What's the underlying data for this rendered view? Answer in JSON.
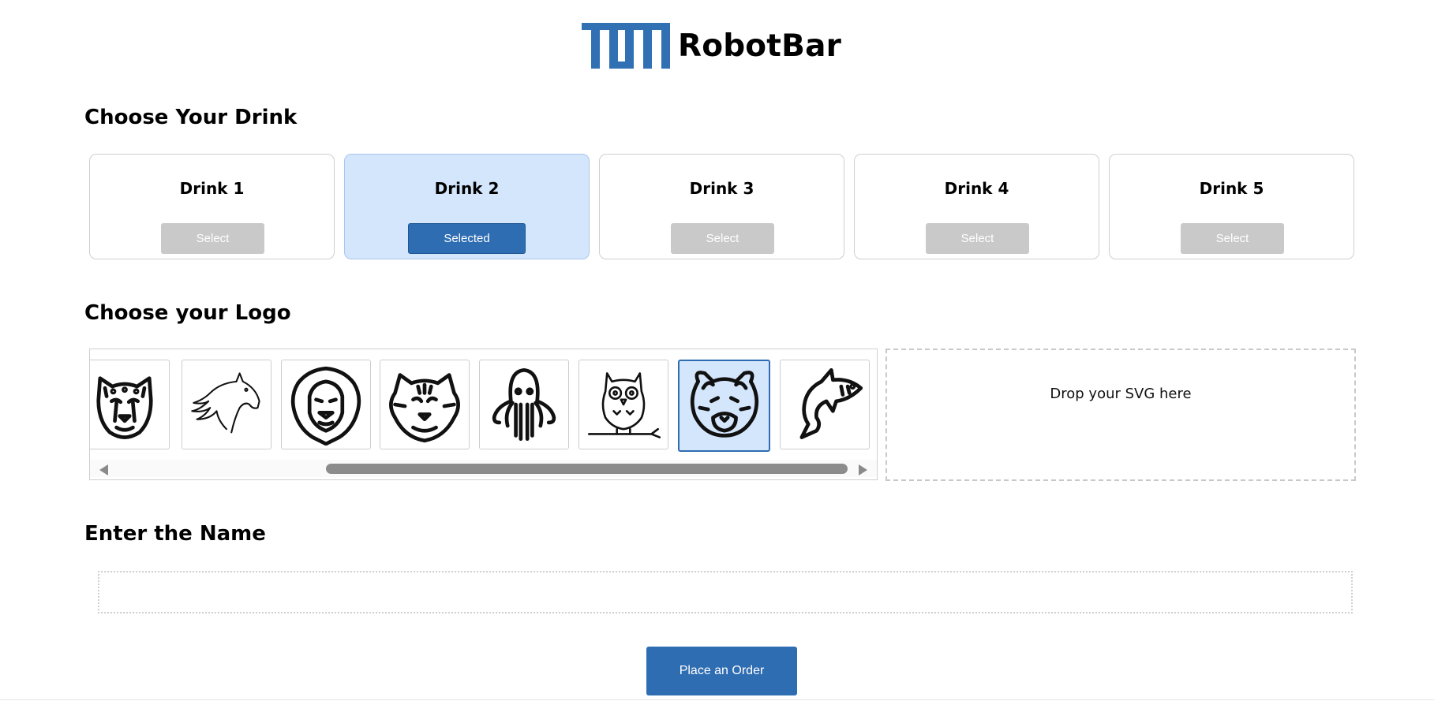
{
  "header": {
    "brand": "RobotBar",
    "logo_icon": "tum-logo-icon",
    "brand_color": "#3070b3"
  },
  "drinks_section": {
    "title": "Choose Your Drink",
    "items": [
      {
        "name": "Drink 1",
        "button": "Select",
        "selected": false
      },
      {
        "name": "Drink 2",
        "button": "Selected",
        "selected": true
      },
      {
        "name": "Drink 3",
        "button": "Select",
        "selected": false
      },
      {
        "name": "Drink 4",
        "button": "Select",
        "selected": false
      },
      {
        "name": "Drink 5",
        "button": "Select",
        "selected": false
      }
    ]
  },
  "logo_section": {
    "title": "Choose your Logo",
    "logos": [
      {
        "icon": "cheetah-icon",
        "selected": false
      },
      {
        "icon": "horse-icon",
        "selected": false
      },
      {
        "icon": "lion-icon",
        "selected": false
      },
      {
        "icon": "tiger-icon",
        "selected": false
      },
      {
        "icon": "octopus-icon",
        "selected": false
      },
      {
        "icon": "owl-icon",
        "selected": false
      },
      {
        "icon": "red-panda-icon",
        "selected": true
      },
      {
        "icon": "shark-icon",
        "selected": false
      }
    ],
    "dropzone_label": "Drop your SVG here"
  },
  "name_section": {
    "title": "Enter the Name",
    "value": "",
    "placeholder": ""
  },
  "order_button": "Place an Order",
  "colors": {
    "accent": "#2f6db2",
    "selected_bg": "#d4e6fc",
    "disabled_button": "#c9c9c9"
  }
}
